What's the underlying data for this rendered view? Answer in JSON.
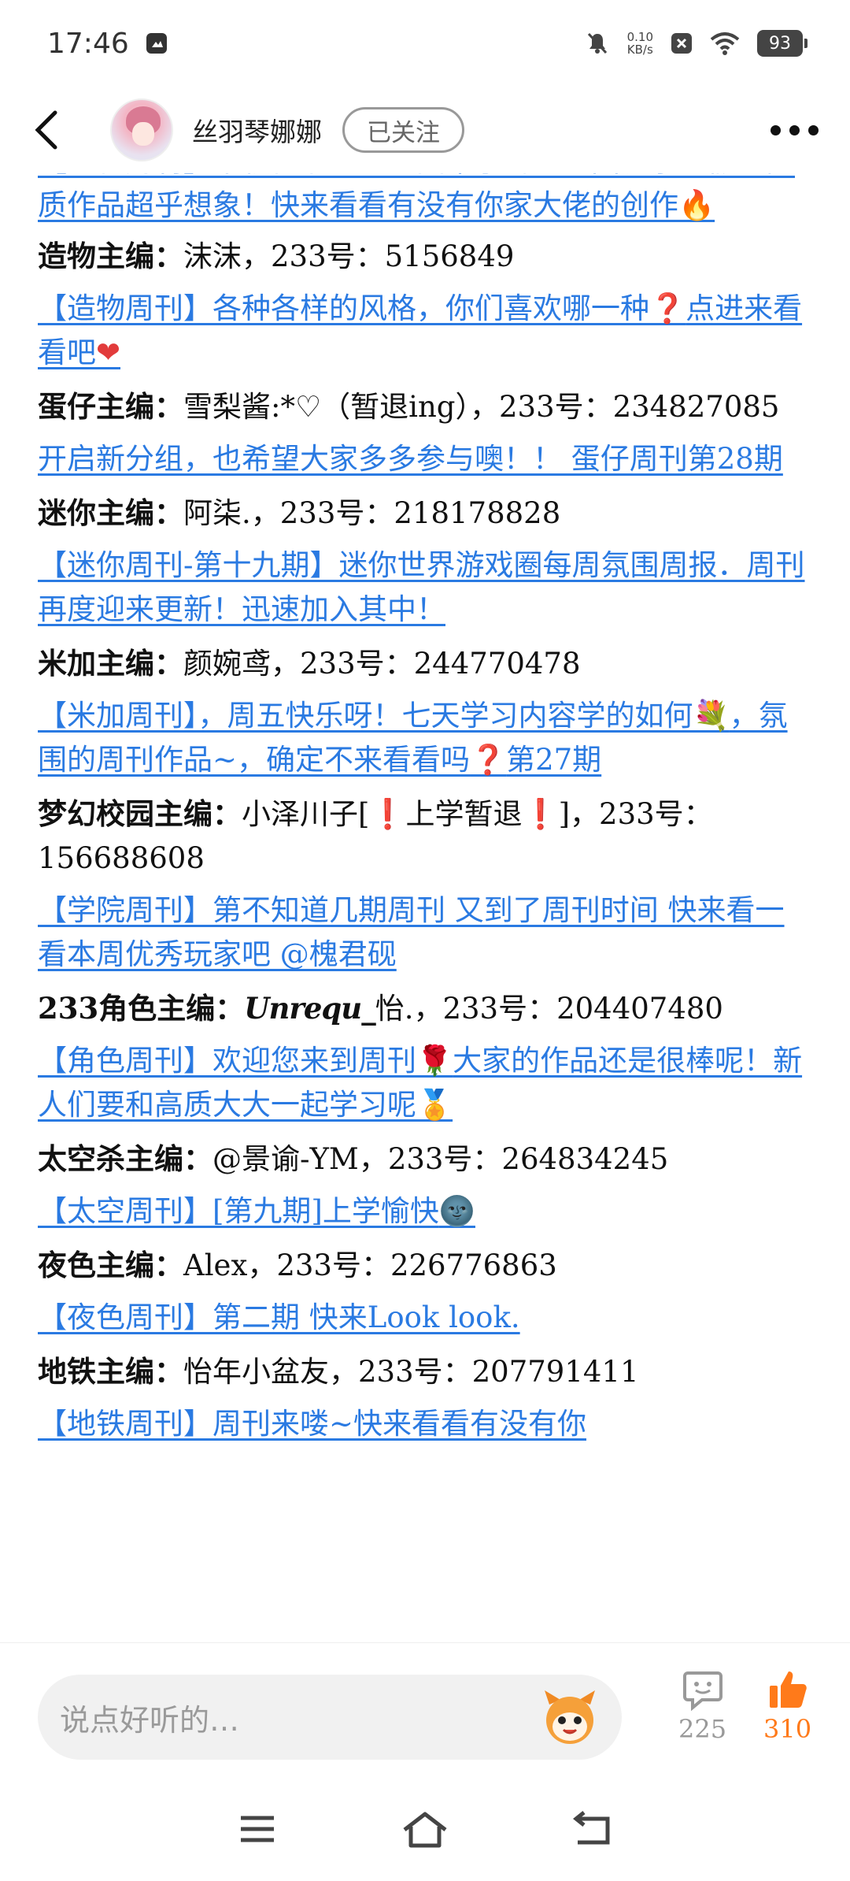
{
  "status_bar": {
    "time": "17:46",
    "net_speed_value": "0.10",
    "net_speed_unit": "KB/s",
    "battery": "93"
  },
  "header": {
    "user_name": "丝羽琴娜娜",
    "follow_label": "已关注"
  },
  "content": {
    "partial_top_link": "【造物周刊】中秋佳节一家人团聚了吗！！国庆小长假的高质作品超乎想象！快来看看有没有你家大佬的创作",
    "entries": [
      {
        "role": "造物主编：",
        "editor": "沫沫，233号：5156849",
        "link": "【造物周刊】各种各样的风格，你们喜欢哪一种",
        "link_tail": "点进来看看吧"
      },
      {
        "role": "蛋仔主编：",
        "editor": "雪梨酱:*♡（暂退ing），233号：234827085",
        "link": "开启新分组，也希望大家多多参与噢！！ 蛋仔周刊第28期"
      },
      {
        "role": "迷你主编：",
        "editor": "阿柒.，233号：218178828",
        "link": "【迷你周刊-第十九期】迷你世界游戏圈每周氛围周报．周刊再度迎来更新！迅速加入其中！"
      },
      {
        "role": "米加主编：",
        "editor": "颜婉鸢，233号：244770478",
        "link": "【米加周刊】，周五快乐呀！七天学习内容学的如何",
        "link_tail": "，氛围的周刊作品~，确定不来看看吗",
        "link_end": "第27期"
      },
      {
        "role": "梦幻校园主编：",
        "editor_a": "小泽川子[",
        "editor_b": "上学暂退",
        "editor_c": "]，233号：156688608",
        "link": "【学院周刊】第不知道几期周刊 又到了周刊时间 快来看一看本周优秀玩家吧 @槐君砚"
      },
      {
        "role": "233角色主编：",
        "editor_script": "Unrequ_",
        "editor": "怡.，233号：204407480",
        "link": "【角色周刊】欢迎您来到周刊",
        "link_tail": "大家的作品还是很棒呢！新人们要和高质大大一起学习呢"
      },
      {
        "role": "太空杀主编：",
        "editor": "@景谕-YM，233号：264834245",
        "link": "【太空周刊】[第九期]上学愉快"
      },
      {
        "role": "夜色主编：",
        "editor": "Alex，233号：226776863",
        "link": "【夜色周刊】第二期 快来Look look."
      },
      {
        "role": "地铁主编：",
        "editor": "怡年小盆友，233号：207791411",
        "link": "【地铁周刊】周刊来喽~快来看看有没有你"
      }
    ]
  },
  "comment_bar": {
    "placeholder": "说点好听的…",
    "comment_count": "225",
    "like_count": "310"
  },
  "icons": {
    "back": "back-arrow-icon",
    "more": "more-dots-icon",
    "comment": "comment-bubble-icon",
    "like": "thumbs-up-icon"
  },
  "colors": {
    "link": "#2a7ae2",
    "accent": "#ff7a1a"
  }
}
